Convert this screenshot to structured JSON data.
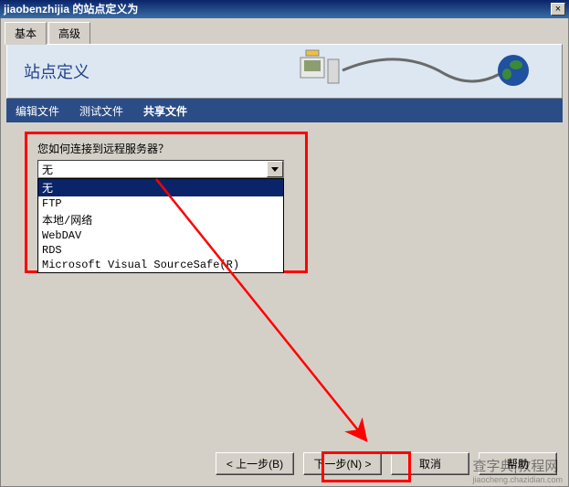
{
  "window": {
    "title": "jiaobenzhijia 的站点定义为"
  },
  "tabs": {
    "basic": "基本",
    "advanced": "高级"
  },
  "header": {
    "title": "站点定义"
  },
  "subnav": {
    "edit": "编辑文件",
    "test": "测试文件",
    "share": "共享文件"
  },
  "prompt": "您如何连接到远程服务器？",
  "combo": {
    "value": "无"
  },
  "options": {
    "none": "无",
    "ftp": "FTP",
    "local": "本地/网络",
    "webdav": "WebDAV",
    "rds": "RDS",
    "vss": "Microsoft Visual SourceSafe(R)"
  },
  "buttons": {
    "back": "< 上一步(B)",
    "next": "下一步(N) >",
    "cancel": "取消",
    "help": "帮助"
  },
  "watermark": {
    "main": "查字典|教程网",
    "sub": "jiaocheng.chazidian.com"
  }
}
